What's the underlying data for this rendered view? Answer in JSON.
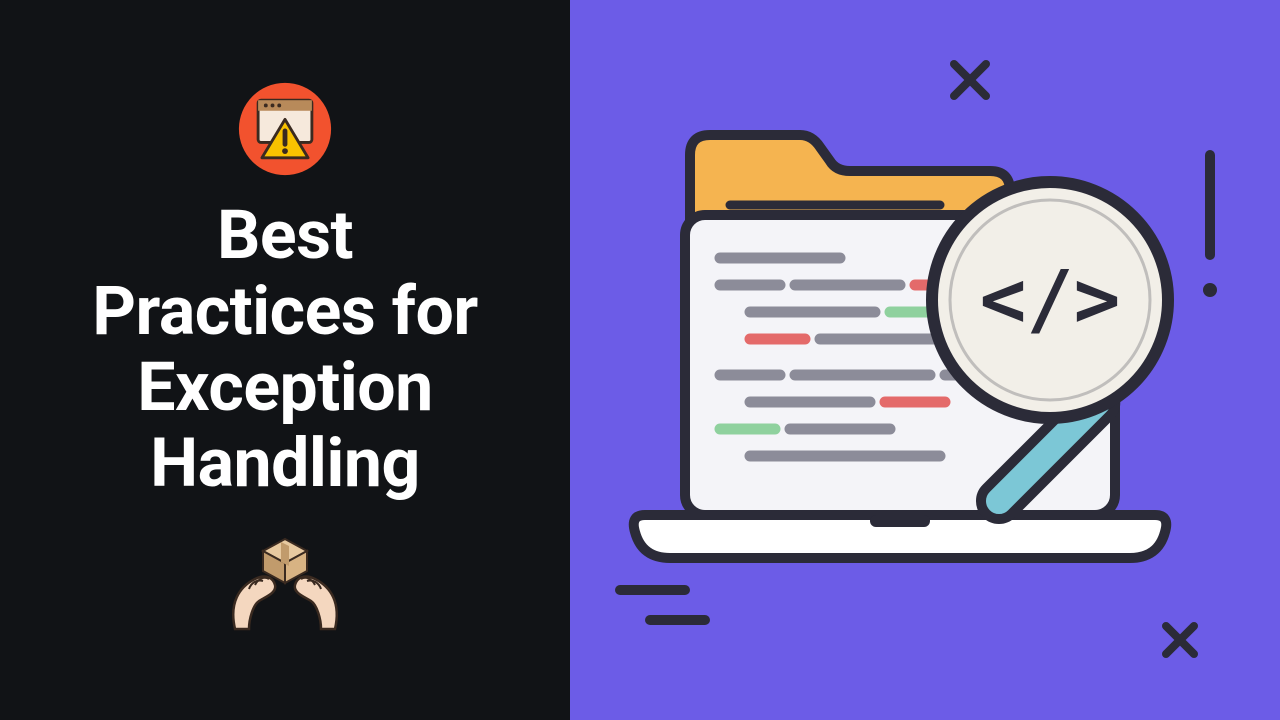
{
  "left_panel": {
    "title_lines": [
      "Best",
      "Practices for",
      "Exception",
      "Handling"
    ],
    "icons": {
      "top": "warning-window-icon",
      "bottom": "hands-box-icon"
    },
    "bg": "#111316",
    "fg": "#FFFFFF"
  },
  "right_panel": {
    "bg": "#6C5CE7",
    "illustration": "laptop-code-magnifier",
    "code_tag_glyph": "</>",
    "accent_colors": {
      "folder": "#F5B450",
      "screen": "#F4F4F8",
      "base": "#FFFFFF",
      "magnifier_glass": "#F2EFE8",
      "magnifier_handle": "#7CC7D6",
      "code_gray": "#8C8C99",
      "code_green": "#8FD19E",
      "code_red": "#E46A6A",
      "line_dark": "#2B2B38"
    }
  }
}
